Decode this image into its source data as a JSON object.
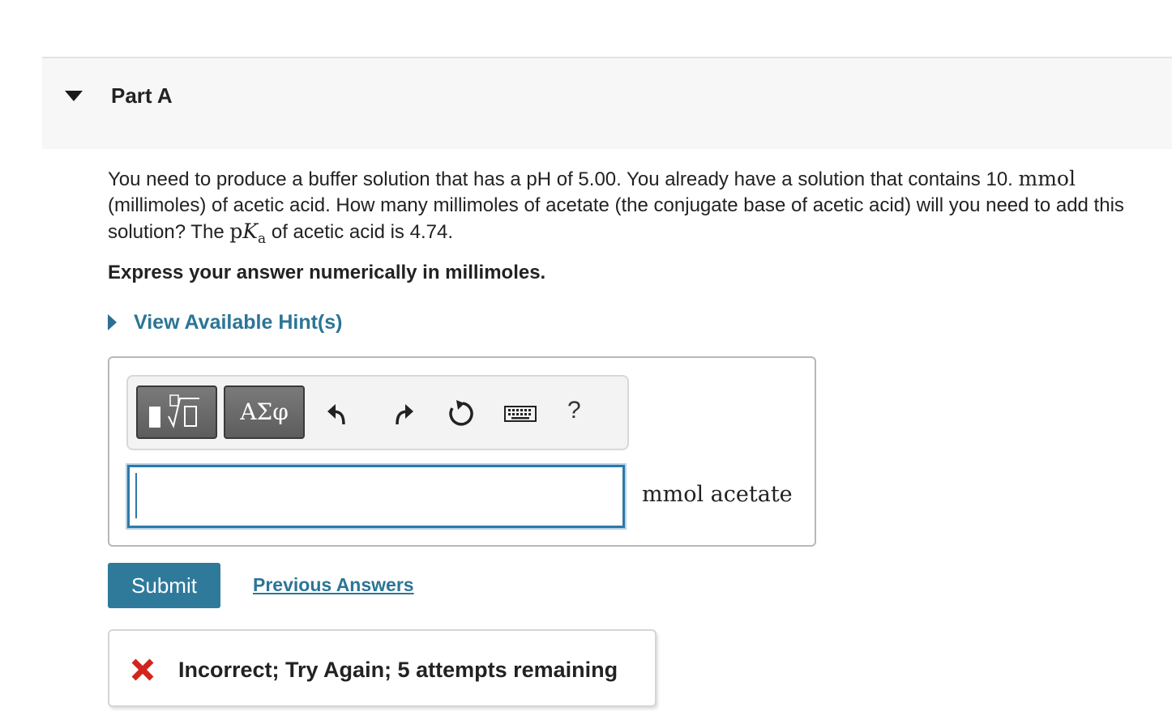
{
  "part": {
    "title": "Part A"
  },
  "question": {
    "text_before_pka": "You need to produce a buffer solution that has a pH of 5.00. You already have a solution that contains 10.",
    "unit_mmol": "mmol",
    "text_middle": "(millimoles) of acetic acid. How many millimoles of acetate (the conjugate base of acetic acid) will you need to add this solution? The",
    "pka_p": "p",
    "pka_k": "K",
    "pka_sub": "a",
    "text_after_pka": "of acetic acid is 4.74."
  },
  "instruction": "Express your answer numerically in millimoles.",
  "hints": {
    "link_label": "View Available Hint(s)"
  },
  "toolbar": {
    "greek_label": "ΑΣφ",
    "help_label": "?"
  },
  "answer": {
    "value": "",
    "unit": "mmol acetate"
  },
  "actions": {
    "submit_label": "Submit",
    "previous_answers_label": "Previous Answers"
  },
  "feedback": {
    "message": "Incorrect; Try Again; 5 attempts remaining",
    "status_color": "#d0261d"
  },
  "colors": {
    "accent": "#2f7a9b",
    "link": "#2c7596",
    "input_focus": "#2d79a8"
  }
}
